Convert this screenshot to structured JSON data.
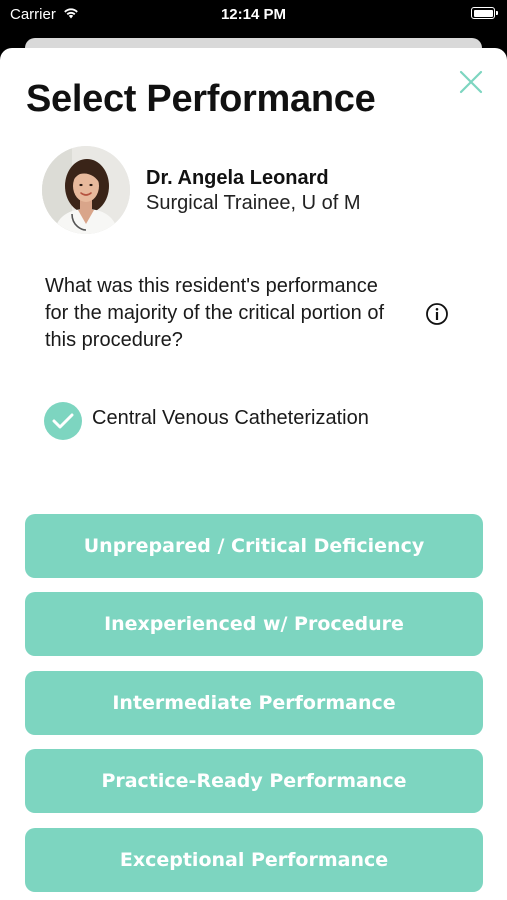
{
  "status_bar": {
    "carrier": "Carrier",
    "time": "12:14 PM"
  },
  "header": {
    "title": "Select Performance"
  },
  "resident": {
    "name": "Dr. Angela Leonard",
    "role": "Surgical Trainee, U of M"
  },
  "question": "What was this resident's performance for the majority of the critical portion of this procedure?",
  "procedure": {
    "label": "Central Venous Catheterization",
    "checked": true
  },
  "options": [
    "Unprepared / Critical Deficiency",
    "Inexperienced w/ Procedure",
    "Intermediate Performance",
    "Practice-Ready Performance",
    "Exceptional Performance"
  ],
  "colors": {
    "accent": "#7dd5c0",
    "background": "#ffffff",
    "status_bar": "#000000"
  },
  "icons": {
    "close": "close-icon",
    "info": "info-icon",
    "check": "checkmark-icon",
    "wifi": "wifi-icon",
    "battery": "battery-icon"
  }
}
